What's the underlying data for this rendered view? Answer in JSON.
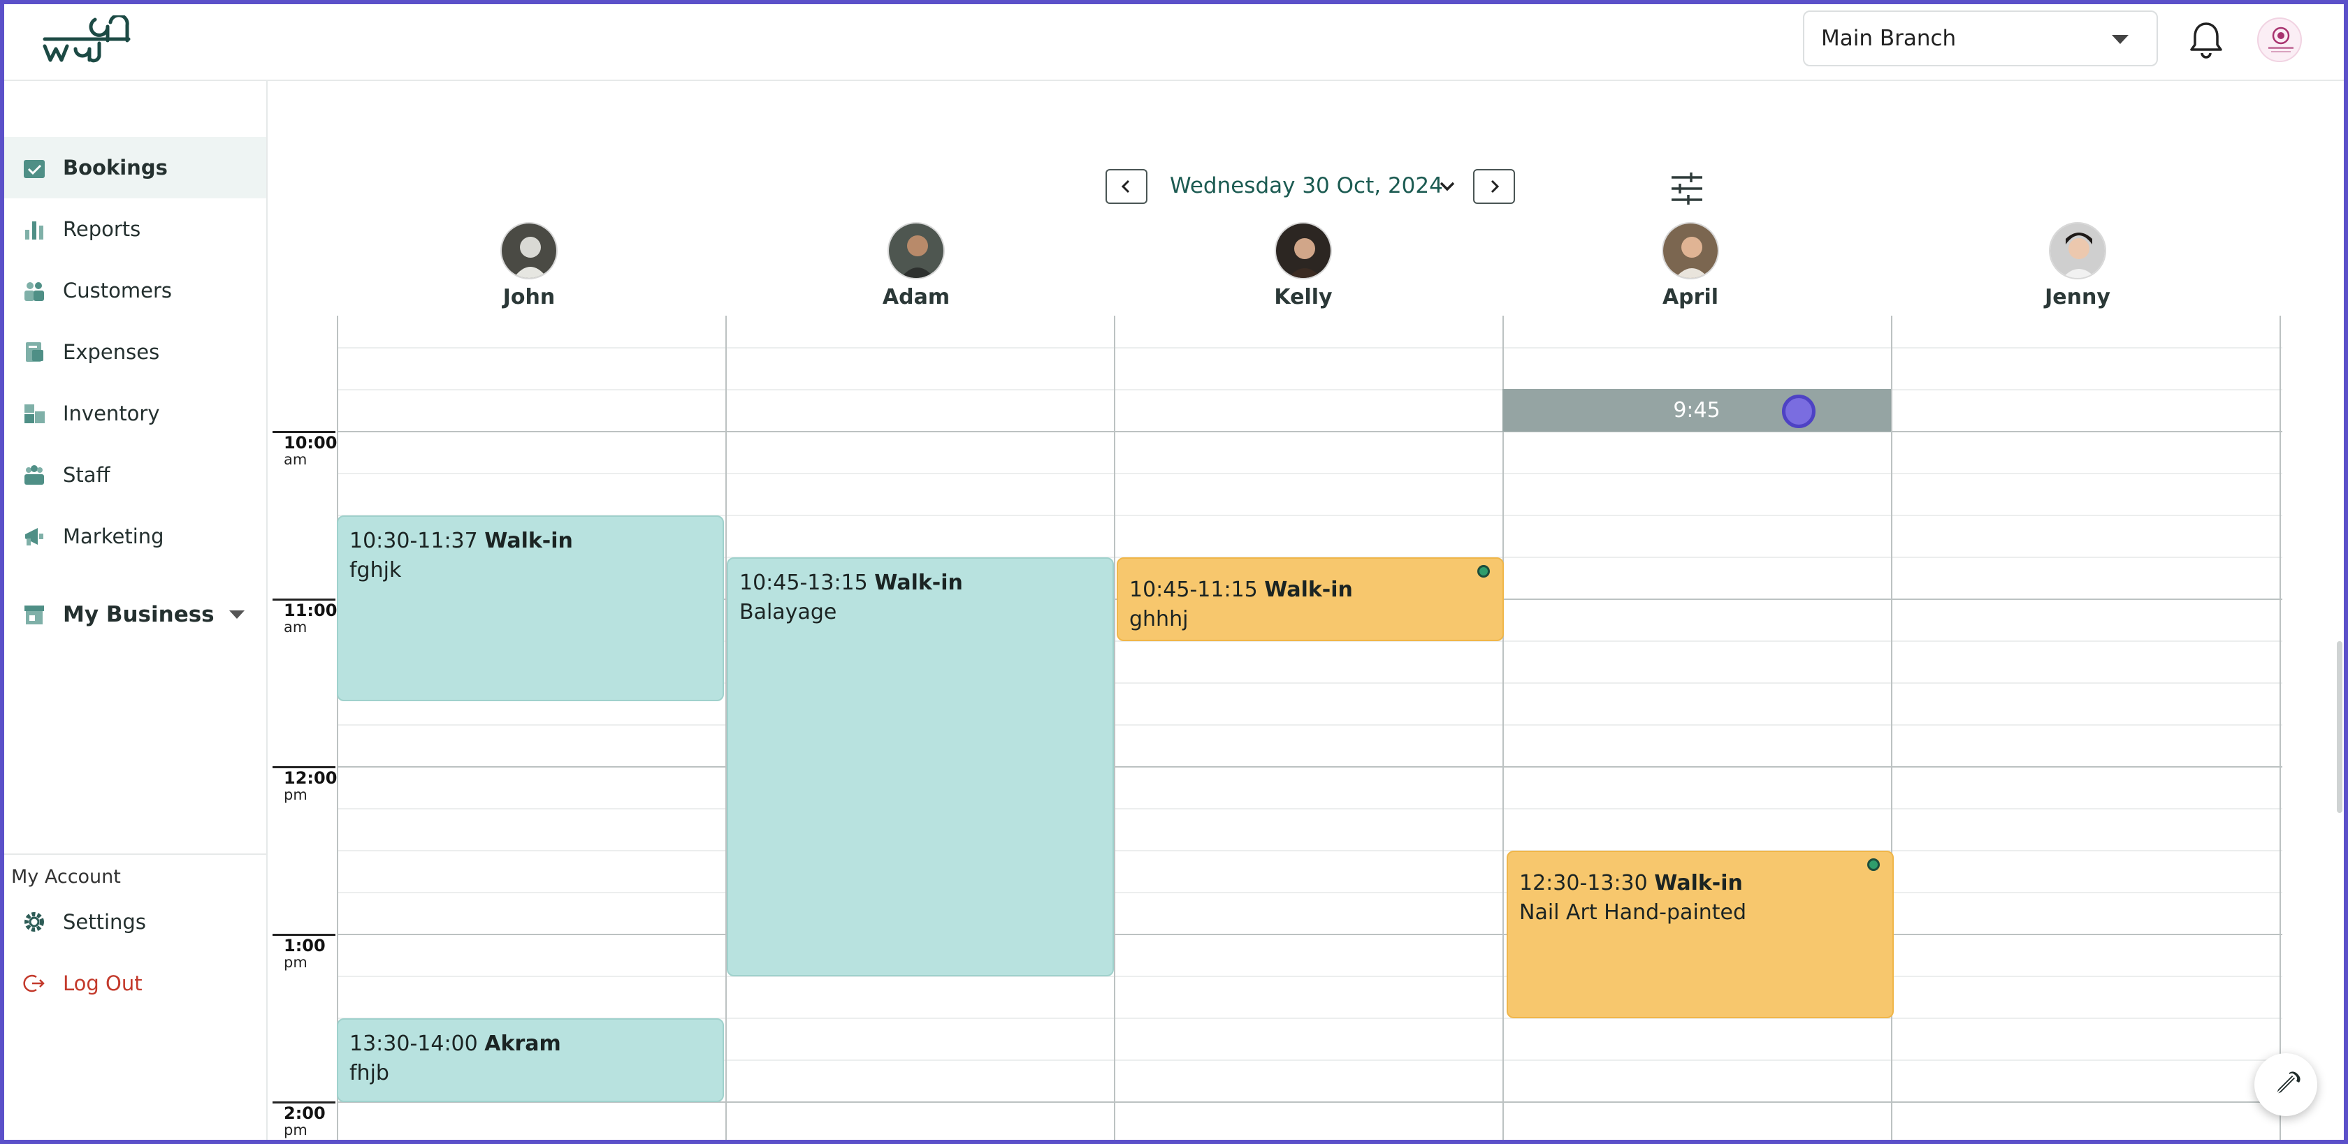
{
  "header": {
    "branch": "Main Branch"
  },
  "sidebar": {
    "items": [
      {
        "label": "Bookings",
        "icon": "calendar-check-icon"
      },
      {
        "label": "Reports",
        "icon": "bar-chart-icon"
      },
      {
        "label": "Customers",
        "icon": "users-icon"
      },
      {
        "label": "Expenses",
        "icon": "receipt-icon"
      },
      {
        "label": "Inventory",
        "icon": "boxes-icon"
      },
      {
        "label": "Staff",
        "icon": "staff-icon"
      },
      {
        "label": "Marketing",
        "icon": "megaphone-icon"
      }
    ],
    "my_business": "My Business",
    "account_label": "My Account",
    "settings": "Settings",
    "logout": "Log Out"
  },
  "calendar": {
    "date": "Wednesday 30 Oct, 2024",
    "staff": [
      "John",
      "Adam",
      "Kelly",
      "April",
      "Jenny"
    ],
    "times": [
      {
        "h": "10:00",
        "ap": "am"
      },
      {
        "h": "11:00",
        "ap": "am"
      },
      {
        "h": "12:00",
        "ap": "pm"
      },
      {
        "h": "1:00",
        "ap": "pm"
      },
      {
        "h": "2:00",
        "ap": "pm"
      }
    ],
    "selected_slot": "9:45",
    "events": [
      {
        "time": "10:30-11:37",
        "who": "Walk-in",
        "service": "fghjk"
      },
      {
        "time": "10:45-13:15",
        "who": "Walk-in",
        "service": "Balayage"
      },
      {
        "time": "10:45-11:15",
        "who": "Walk-in",
        "service": "ghhhj"
      },
      {
        "time": "12:30-13:30",
        "who": "Walk-in",
        "service": "Nail Art Hand-painted"
      },
      {
        "time": "13:30-14:00",
        "who": "Akram",
        "service": "fhjb"
      }
    ]
  },
  "colors": {
    "accent": "#1c5b52",
    "teal_event": "#b8e2df",
    "orange_event": "#f7c76d",
    "frame": "#5b50c9"
  }
}
